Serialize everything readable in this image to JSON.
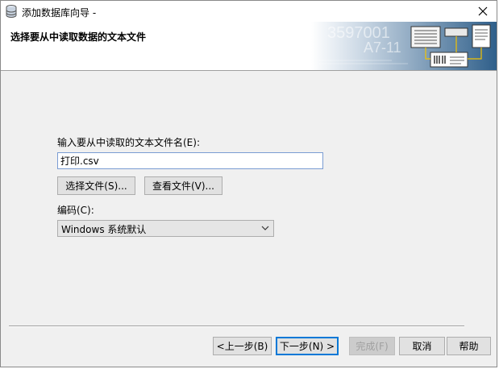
{
  "window": {
    "title": "添加数据库向导 -",
    "close_glyph": "✕"
  },
  "header": {
    "heading": "选择要从中读取数据的文本文件",
    "banner_numbers": [
      "3597001",
      "A7-11"
    ]
  },
  "form": {
    "file_label": "输入要从中读取的文本文件名(E):",
    "file_value": "打印.csv",
    "choose_file_button": "选择文件(S)...",
    "view_file_button": "查看文件(V)...",
    "encoding_label": "编码(C):",
    "encoding_value": "Windows 系统默认"
  },
  "footer": {
    "back_button": "<上一步(B)",
    "next_button": "下一步(N) >",
    "finish_button": "完成(F)",
    "cancel_button": "取消",
    "help_button": "帮助"
  },
  "icons": [
    "database-icon",
    "close-icon",
    "wizard-banner-icon",
    "dropdown-arrow-icon"
  ]
}
